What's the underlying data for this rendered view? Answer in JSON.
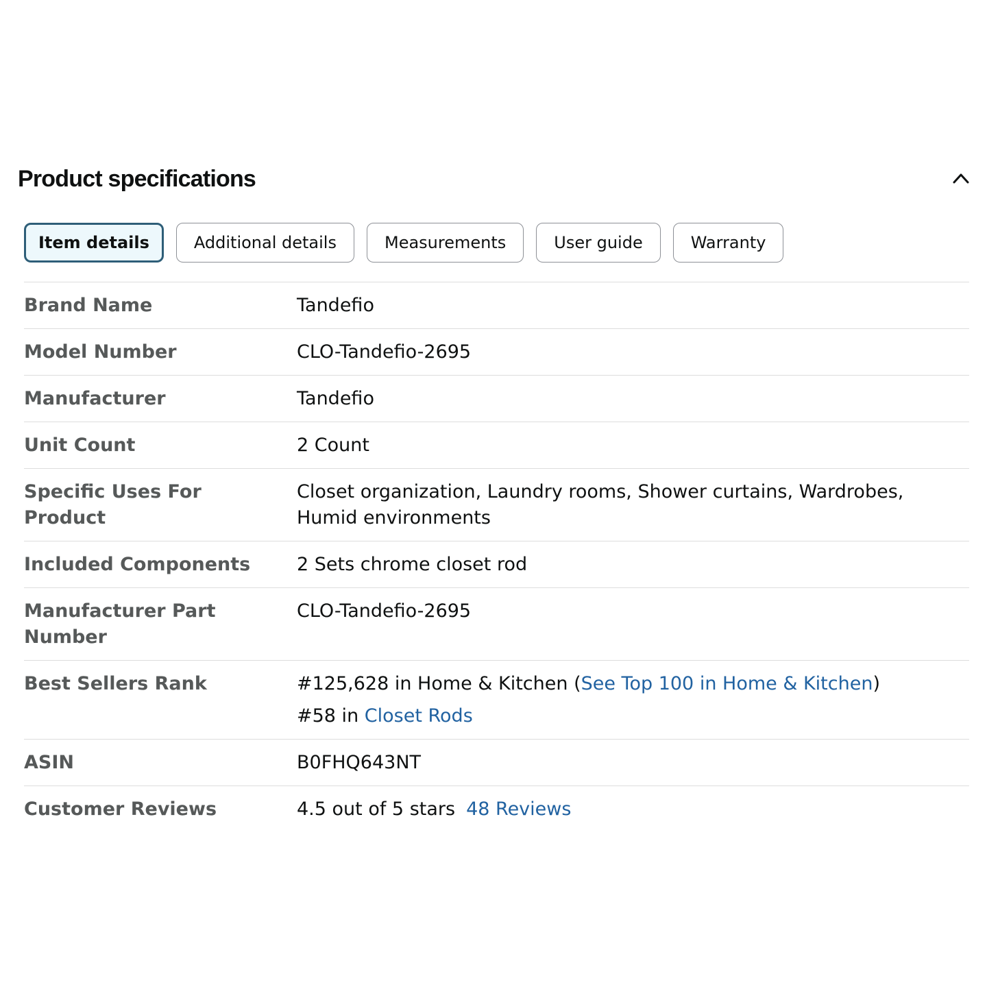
{
  "section": {
    "title": "Product specifications",
    "collapse_icon": "chevron-up-icon"
  },
  "tabs": [
    {
      "label": "Item details",
      "active": true
    },
    {
      "label": "Additional details",
      "active": false
    },
    {
      "label": "Measurements",
      "active": false
    },
    {
      "label": "User guide",
      "active": false
    },
    {
      "label": "Warranty",
      "active": false
    }
  ],
  "specs": {
    "brand_name": {
      "label": "Brand Name",
      "value": "Tandefio"
    },
    "model_number": {
      "label": "Model Number",
      "value": "CLO-Tandefio-2695"
    },
    "manufacturer": {
      "label": "Manufacturer",
      "value": "Tandefio"
    },
    "unit_count": {
      "label": "Unit Count",
      "value": "2 Count"
    },
    "specific_uses": {
      "label": "Specific Uses For Product",
      "value": "Closet organization, Laundry rooms, Shower curtains, Wardrobes, Humid environments"
    },
    "included_components": {
      "label": "Included Components",
      "value": "2 Sets chrome closet rod"
    },
    "manufacturer_part_number": {
      "label": "Manufacturer Part Number",
      "value": "CLO-Tandefio-2695"
    },
    "best_sellers_rank": {
      "label": "Best Sellers Rank",
      "rank1_prefix": "#125,628 in Home & Kitchen (",
      "rank1_link": "See Top 100 in Home & Kitchen",
      "rank1_suffix": ")",
      "rank2_prefix": "#58 in ",
      "rank2_link": "Closet Rods"
    },
    "asin": {
      "label": "ASIN",
      "value": "B0FHQ643NT"
    },
    "customer_reviews": {
      "label": "Customer Reviews",
      "rating_text": "4.5 out of 5 stars",
      "reviews_count": "48",
      "reviews_label": "Reviews"
    }
  },
  "colors": {
    "link": "#2162a1",
    "label": "#565959",
    "active_tab_border": "#2e5e78",
    "active_tab_bg": "#edf8fc",
    "divider": "#dddddd"
  }
}
